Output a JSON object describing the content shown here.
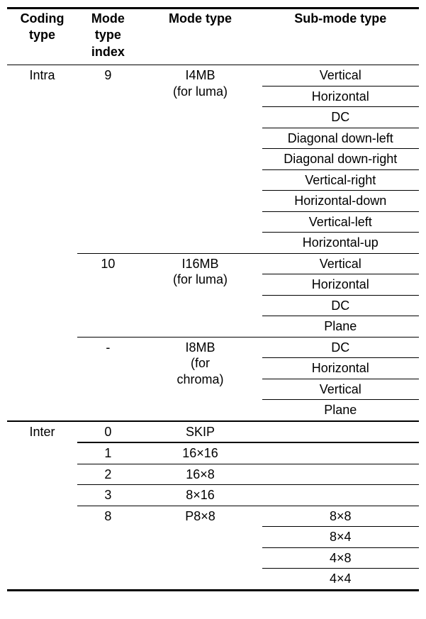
{
  "headers": {
    "c1": "Coding type",
    "c2": "Mode type index",
    "c3": "Mode type",
    "c4": "Sub-mode type"
  },
  "coding": {
    "intra": "Intra",
    "inter": "Inter"
  },
  "idx": {
    "i4": "9",
    "i16": "10",
    "i8": "-",
    "skip": "0",
    "m1616": "1",
    "m168": "2",
    "m816": "3",
    "p88": "8"
  },
  "mode": {
    "i4_l1": "I4MB",
    "i4_l2": "(for luma)",
    "i16_l1": "I16MB",
    "i16_l2": "(for luma)",
    "i8_l1": "I8MB",
    "i8_l2": "(for",
    "i8_l3": "chroma)",
    "skip": "SKIP",
    "m1616": "16×16",
    "m168": "16×8",
    "m816": "8×16",
    "p88": "P8×8"
  },
  "sub": {
    "i4": {
      "s0": "Vertical",
      "s1": "Horizontal",
      "s2": "DC",
      "s3": "Diagonal down-left",
      "s4": "Diagonal down-right",
      "s5": "Vertical-right",
      "s6": "Horizontal-down",
      "s7": "Vertical-left",
      "s8": "Horizontal-up"
    },
    "i16": {
      "s0": "Vertical",
      "s1": "Horizontal",
      "s2": "DC",
      "s3": "Plane"
    },
    "i8": {
      "s0": "DC",
      "s1": "Horizontal",
      "s2": "Vertical",
      "s3": "Plane"
    },
    "p88": {
      "s0": "8×8",
      "s1": "8×4",
      "s2": "4×8",
      "s3": "4×4"
    }
  },
  "chart_data": {
    "type": "table",
    "title": "",
    "columns": [
      "Coding type",
      "Mode type index",
      "Mode type",
      "Sub-mode type"
    ],
    "rows": [
      [
        "Intra",
        "9",
        "I4MB (for luma)",
        "Vertical"
      ],
      [
        "Intra",
        "9",
        "I4MB (for luma)",
        "Horizontal"
      ],
      [
        "Intra",
        "9",
        "I4MB (for luma)",
        "DC"
      ],
      [
        "Intra",
        "9",
        "I4MB (for luma)",
        "Diagonal down-left"
      ],
      [
        "Intra",
        "9",
        "I4MB (for luma)",
        "Diagonal down-right"
      ],
      [
        "Intra",
        "9",
        "I4MB (for luma)",
        "Vertical-right"
      ],
      [
        "Intra",
        "9",
        "I4MB (for luma)",
        "Horizontal-down"
      ],
      [
        "Intra",
        "9",
        "I4MB (for luma)",
        "Vertical-left"
      ],
      [
        "Intra",
        "9",
        "I4MB (for luma)",
        "Horizontal-up"
      ],
      [
        "Intra",
        "10",
        "I16MB (for luma)",
        "Vertical"
      ],
      [
        "Intra",
        "10",
        "I16MB (for luma)",
        "Horizontal"
      ],
      [
        "Intra",
        "10",
        "I16MB (for luma)",
        "DC"
      ],
      [
        "Intra",
        "10",
        "I16MB (for luma)",
        "Plane"
      ],
      [
        "Intra",
        "-",
        "I8MB (for chroma)",
        "DC"
      ],
      [
        "Intra",
        "-",
        "I8MB (for chroma)",
        "Horizontal"
      ],
      [
        "Intra",
        "-",
        "I8MB (for chroma)",
        "Vertical"
      ],
      [
        "Intra",
        "-",
        "I8MB (for chroma)",
        "Plane"
      ],
      [
        "Inter",
        "0",
        "SKIP",
        ""
      ],
      [
        "Inter",
        "1",
        "16×16",
        ""
      ],
      [
        "Inter",
        "2",
        "16×8",
        ""
      ],
      [
        "Inter",
        "3",
        "8×16",
        ""
      ],
      [
        "Inter",
        "8",
        "P8×8",
        "8×8"
      ],
      [
        "Inter",
        "8",
        "P8×8",
        "8×4"
      ],
      [
        "Inter",
        "8",
        "P8×8",
        "4×8"
      ],
      [
        "Inter",
        "8",
        "P8×8",
        "4×4"
      ]
    ]
  }
}
